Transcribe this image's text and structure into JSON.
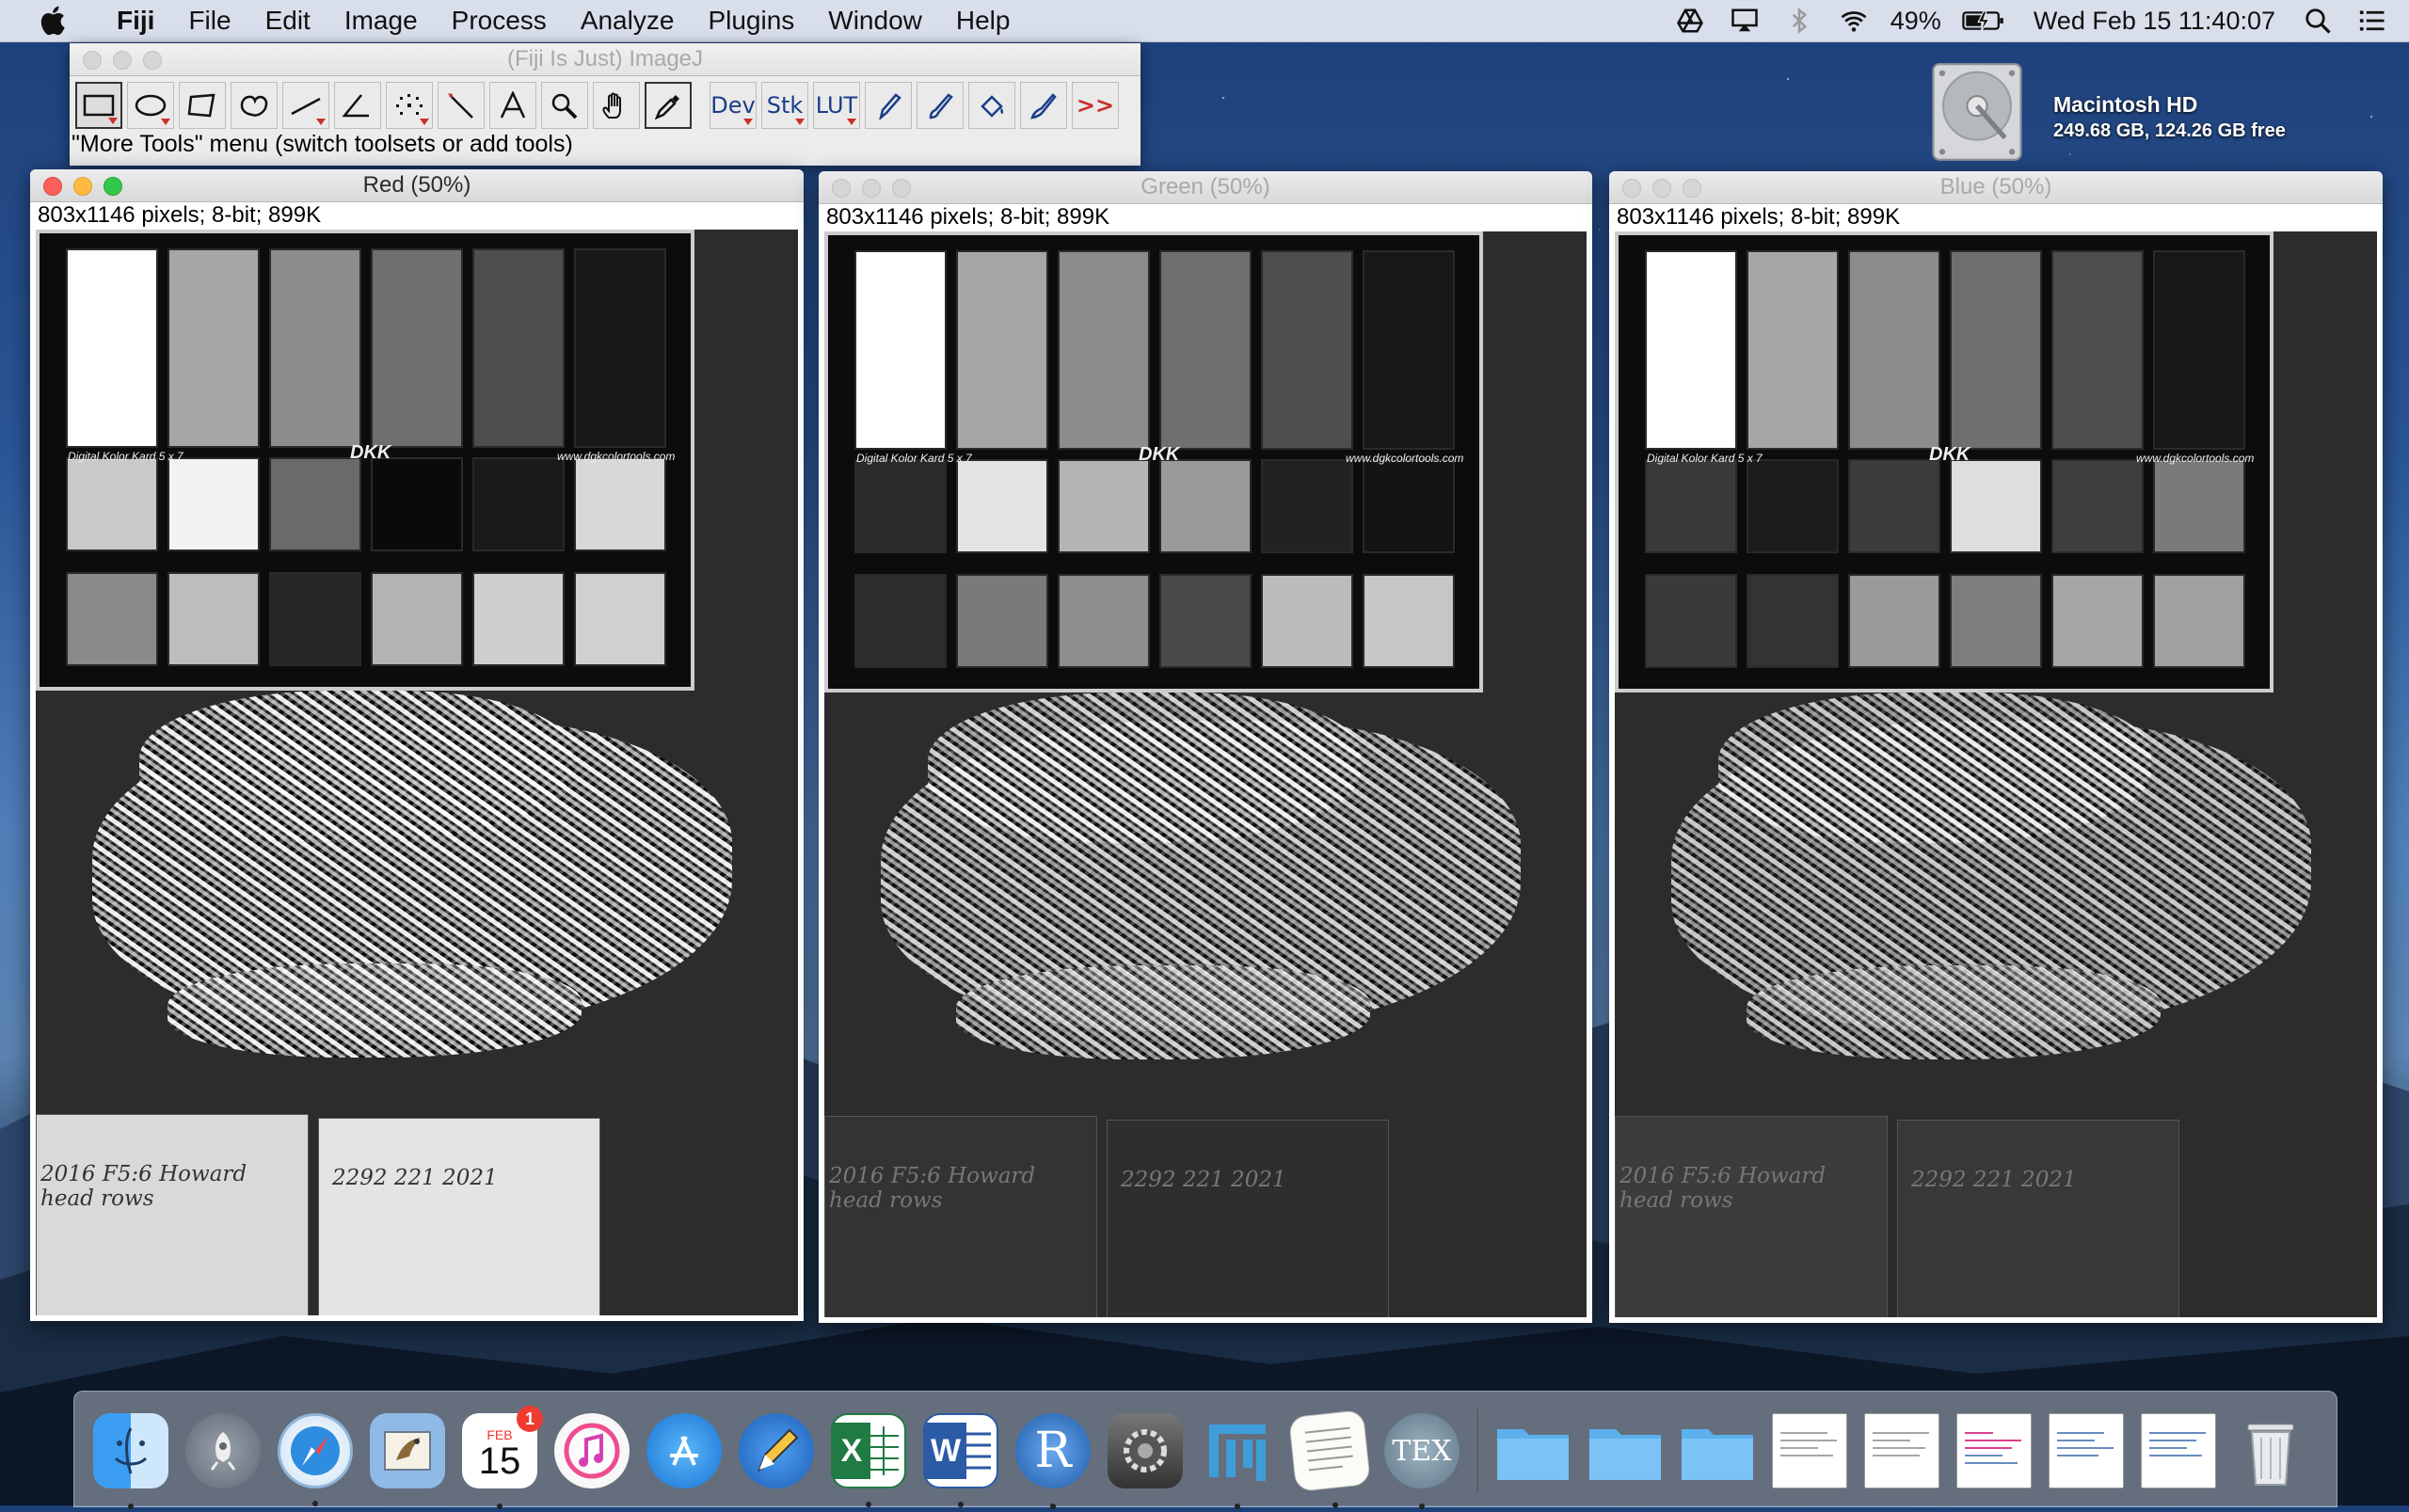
{
  "menubar": {
    "app_name": "Fiji",
    "menus": [
      "File",
      "Edit",
      "Image",
      "Process",
      "Analyze",
      "Plugins",
      "Window",
      "Help"
    ],
    "battery": "49%",
    "clock": "Wed Feb 15  11:40:07",
    "status_icons": [
      "google-drive-icon",
      "airplay-icon",
      "bluetooth-icon",
      "wifi-icon",
      "battery-charging-icon",
      "spotlight-icon",
      "notification-center-icon"
    ]
  },
  "desktop": {
    "disk_name": "Macintosh HD",
    "disk_info": "249.68 GB, 124.26 GB free"
  },
  "toolbar": {
    "title": "(Fiji Is Just) ImageJ",
    "status": "\"More Tools\" menu (switch toolsets or add tools)",
    "tools": [
      "rectangle-tool",
      "oval-tool",
      "polygon-tool",
      "freehand-tool",
      "line-tool",
      "angle-tool",
      "point-tool",
      "wand-tool",
      "text-tool",
      "magnifier-tool",
      "hand-tool",
      "color-picker-tool"
    ],
    "text_tools": [
      "Dev",
      "Stk",
      "LUT"
    ],
    "more_tools": ">>"
  },
  "windows": [
    {
      "title": "Red (50%)",
      "info": "803x1146 pixels; 8-bit; 899K"
    },
    {
      "title": "Green (50%)",
      "info": "803x1146 pixels; 8-bit; 899K"
    },
    {
      "title": "Blue (50%)",
      "info": "803x1146 pixels; 8-bit; 899K"
    }
  ],
  "card": {
    "left_label": "Digital Kolor Kard 5 x 7",
    "center_label": "DKK",
    "right_label": "www.dgkcolortools.com",
    "swatches": {
      "red": {
        "top": [
          "#ffffff",
          "#a6a6a6",
          "#8c8c8c",
          "#6f6f6f",
          "#4e4e4e",
          "#181818"
        ],
        "mid": [
          "#c9c9c9",
          "#f2f2f2",
          "#6a6a6a",
          "#0a0a0a",
          "#1a1a1a",
          "#d8d8d8"
        ],
        "bot": [
          "#8a8a8a",
          "#bdbdbd",
          "#262626",
          "#b3b3b3",
          "#cfcfcf",
          "#d0d0d0"
        ]
      },
      "green": {
        "top": [
          "#ffffff",
          "#a6a6a6",
          "#8c8c8c",
          "#6f6f6f",
          "#4e4e4e",
          "#181818"
        ],
        "mid": [
          "#2a2a2a",
          "#e4e4e4",
          "#b4b4b4",
          "#9a9a9a",
          "#222222",
          "#141414"
        ],
        "bot": [
          "#2c2c2c",
          "#7a7a7a",
          "#8e8e8e",
          "#4a4a4a",
          "#bcbcbc",
          "#c6c6c6"
        ]
      },
      "blue": {
        "top": [
          "#ffffff",
          "#a6a6a6",
          "#8c8c8c",
          "#6f6f6f",
          "#4e4e4e",
          "#181818"
        ],
        "mid": [
          "#3a3a3a",
          "#1c1c1c",
          "#3c3c3c",
          "#dedede",
          "#3e3e3e",
          "#7a7a7a"
        ],
        "bot": [
          "#3a3a3a",
          "#333333",
          "#9a9a9a",
          "#7e7e7e",
          "#a6a6a6",
          "#a0a0a0"
        ]
      }
    },
    "paper_left": "2016 F5:6 Howard head rows",
    "paper_right": "2292 221 2021"
  },
  "dock": {
    "apps": [
      "finder-icon",
      "launchpad-icon",
      "safari-icon",
      "mail-icon",
      "calendar-icon",
      "itunes-icon",
      "app-store-icon",
      "pen-icon",
      "excel-icon",
      "word-icon",
      "r-icon",
      "system-preferences-icon",
      "fiji-icon",
      "textedit-icon",
      "tex-icon"
    ],
    "calendar_month": "FEB",
    "calendar_day": "15",
    "calendar_badge": "1",
    "docs": [
      "folder-icon",
      "folder-icon",
      "folder-icon",
      "doc-thumb-icon",
      "doc-thumb-icon",
      "doc-thumb-icon",
      "doc-thumb-icon",
      "doc-thumb-icon",
      "trash-icon"
    ]
  }
}
